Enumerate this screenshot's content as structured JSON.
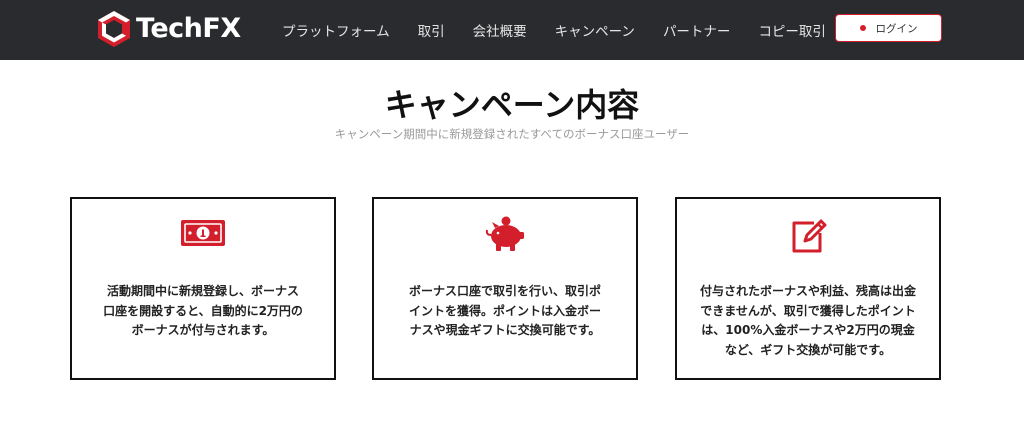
{
  "header": {
    "logo_text": "TechFX",
    "nav_items": [
      "プラットフォーム",
      "取引",
      "会社概要",
      "キャンペーン",
      "パートナー",
      "コピー取引"
    ],
    "login_label": "ログイン"
  },
  "main": {
    "title": "キャンペーン内容",
    "subtitle": "キャンペーン期間中に新規登録されたすべてのボーナス口座ユーザー",
    "cards": [
      {
        "icon": "money-bill-icon",
        "text": "活動期間中に新規登録し、ボーナス口座を開設すると、自動的に2万円のボーナスが付与されます。"
      },
      {
        "icon": "piggy-bank-icon",
        "text": "ボーナス口座で取引を行い、取引ポイントを獲得。ポイントは入金ボーナスや現金ギフトに交換可能です。"
      },
      {
        "icon": "edit-icon",
        "text": "付与されたボーナスや利益、残高は出金できませんが、取引で獲得したポイントは、100%入金ボーナスや2万円の現金など、ギフト交換が可能です。"
      }
    ]
  },
  "colors": {
    "header_bg": "#2a2b2e",
    "accent": "#d21f2b",
    "card_border": "#111111"
  }
}
